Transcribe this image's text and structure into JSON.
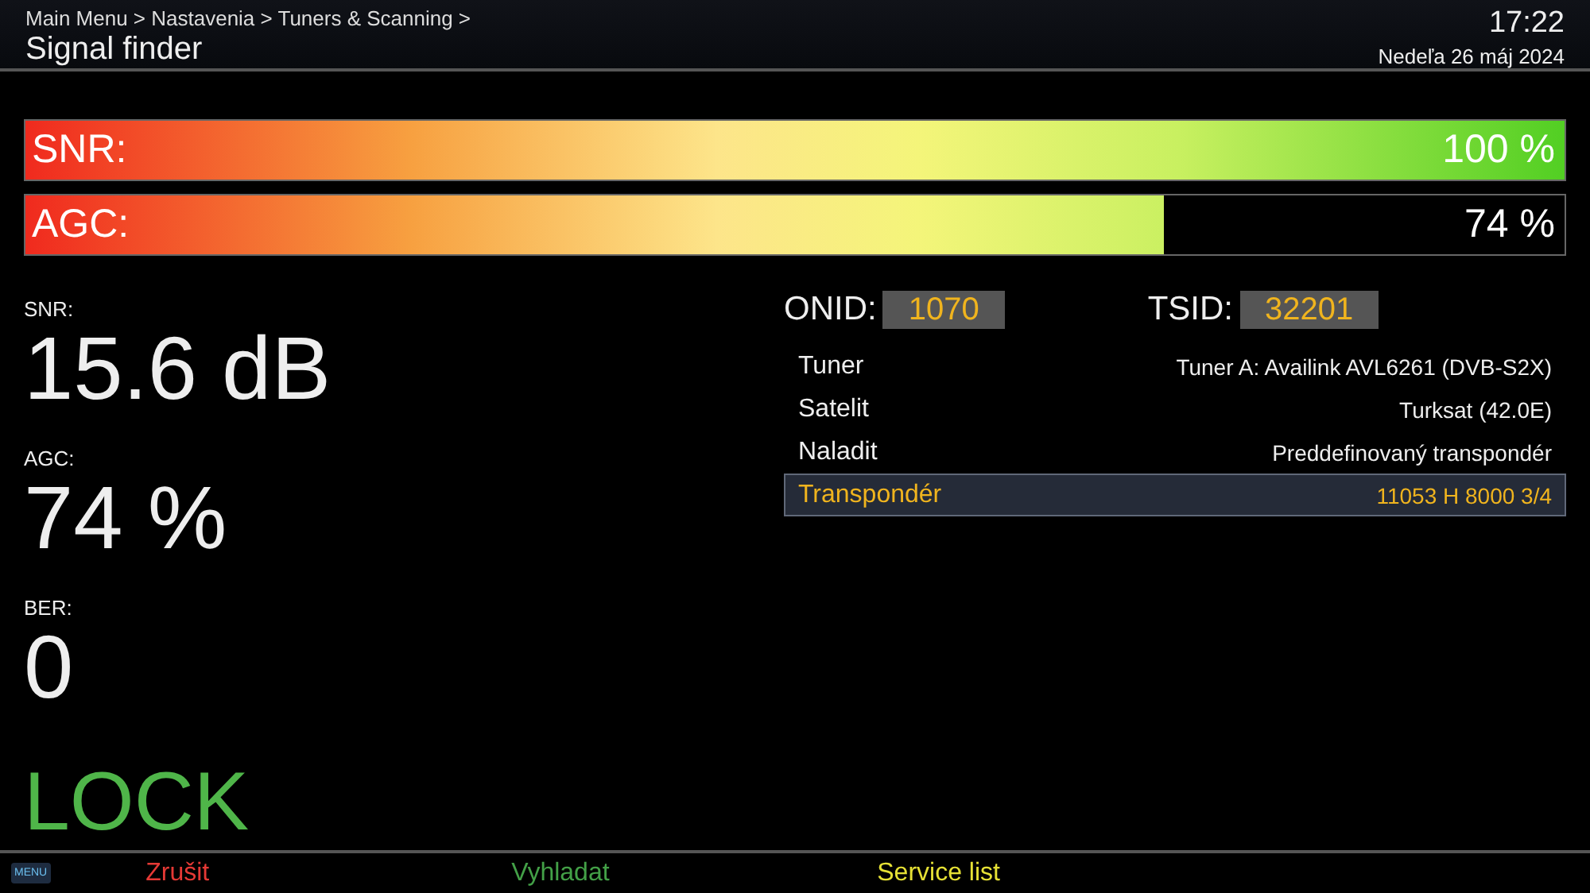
{
  "header": {
    "breadcrumb": "Main Menu > Nastavenia > Tuners & Scanning >",
    "title": "Signal finder",
    "time": "17:22",
    "date": "Nedeľa 26 máj 2024"
  },
  "bars": [
    {
      "label": "SNR:",
      "reading": "100 %",
      "level": 1.0
    },
    {
      "label": "AGC:",
      "reading": "74 %",
      "level": 0.74
    }
  ],
  "stats": [
    {
      "label": "SNR:",
      "value": "15.6 dB"
    },
    {
      "label": "AGC:",
      "value": "74 %"
    },
    {
      "label": "BER:",
      "value": "0"
    }
  ],
  "lock_status": "LOCK",
  "ids": [
    {
      "label": "ONID:",
      "value": "1070"
    },
    {
      "label": "TSID:",
      "value": "32201"
    }
  ],
  "settings": [
    {
      "label": "Tuner",
      "value": "Tuner A: Availink AVL6261 (DVB-S2X)",
      "selected": false
    },
    {
      "label": "Satelit",
      "value": "Turksat (42.0E)",
      "selected": false
    },
    {
      "label": "Naladit",
      "value": "Preddefinovaný transpondér",
      "selected": false
    },
    {
      "label": "Transpondér",
      "value": "11053 H 8000 3/4",
      "selected": true
    }
  ],
  "footer": {
    "menu_key": "MENU",
    "buttons": [
      {
        "label": "Zrušit",
        "color": "#e53935"
      },
      {
        "label": "Vyhladat",
        "color": "#43a047"
      },
      {
        "label": "Service list",
        "color": "#e6e135"
      }
    ]
  }
}
